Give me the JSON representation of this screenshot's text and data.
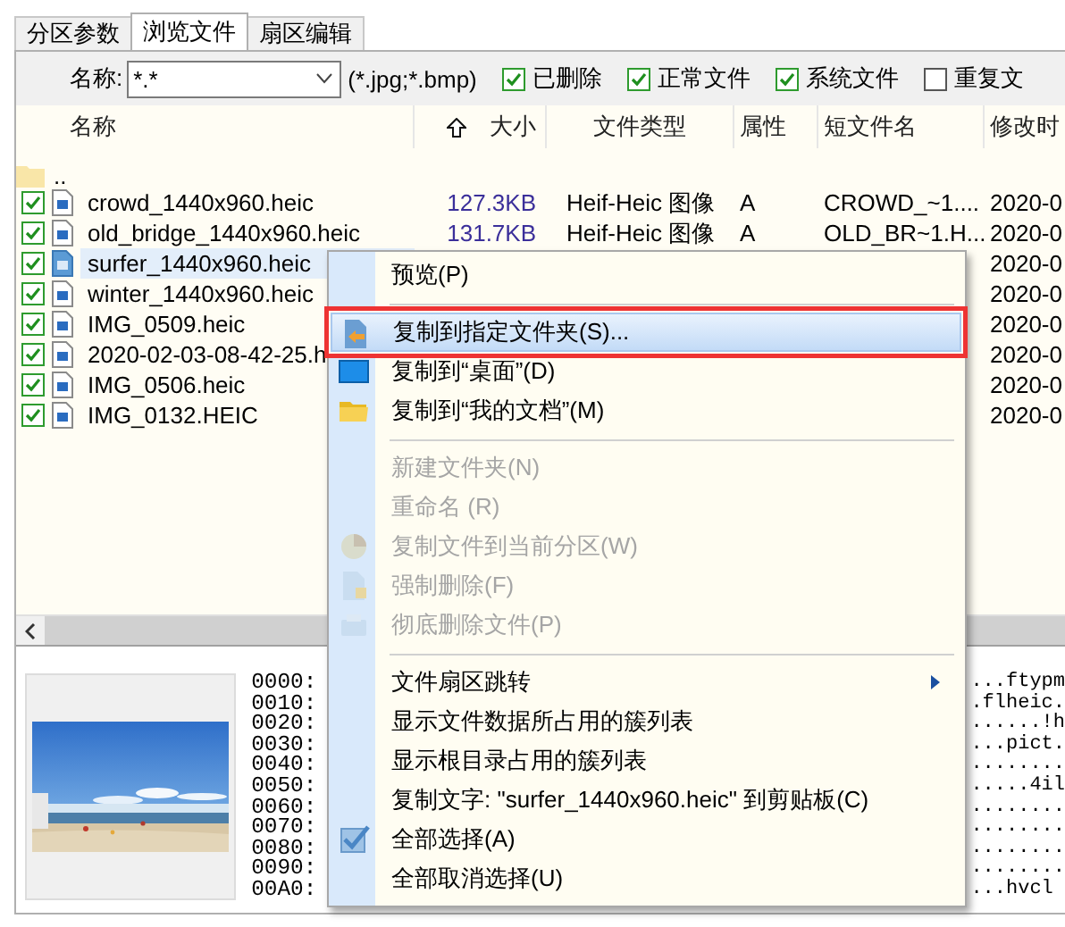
{
  "tabs": [
    {
      "label": "分区参数",
      "selected": false
    },
    {
      "label": "浏览文件",
      "selected": true
    },
    {
      "label": "扇区编辑",
      "selected": false
    }
  ],
  "filter": {
    "name_label": "名称:",
    "name_value": "*.*",
    "hint": "(*.jpg;*.bmp)",
    "options": [
      {
        "label": "已删除",
        "checked": true
      },
      {
        "label": "正常文件",
        "checked": true
      },
      {
        "label": "系统文件",
        "checked": true
      },
      {
        "label": "重复文",
        "checked": false
      }
    ]
  },
  "file_list": {
    "columns": [
      {
        "label": "名称",
        "sorted": false
      },
      {
        "label": "大小",
        "sorted": true
      },
      {
        "label": "文件类型",
        "sorted": false
      },
      {
        "label": "属性",
        "sorted": false
      },
      {
        "label": "短文件名",
        "sorted": false
      },
      {
        "label": "修改时",
        "sorted": false
      }
    ],
    "rows": [
      {
        "kind": "parent",
        "name": ".."
      },
      {
        "kind": "file",
        "checked": true,
        "selected": false,
        "name": "crowd_1440x960.heic",
        "size": "127.3KB",
        "type": "Heif-Heic 图像",
        "attr": "A",
        "short_name": "CROWD_~1....",
        "modified": "2020-0"
      },
      {
        "kind": "file",
        "checked": true,
        "selected": false,
        "name": "old_bridge_1440x960.heic",
        "size": "131.7KB",
        "type": "Heif-Heic 图像",
        "attr": "A",
        "short_name": "OLD_BR~1.H...",
        "modified": "2020-0"
      },
      {
        "kind": "file",
        "checked": true,
        "selected": true,
        "name": "surfer_1440x960.heic",
        "modified": "2020-0"
      },
      {
        "kind": "file",
        "checked": true,
        "selected": false,
        "name": "winter_1440x960.heic",
        "modified": "2020-0"
      },
      {
        "kind": "file",
        "checked": true,
        "selected": false,
        "name": "IMG_0509.heic",
        "modified": "2020-0"
      },
      {
        "kind": "file",
        "checked": true,
        "selected": false,
        "name": "2020-02-03-08-42-25.h",
        "modified": "2020-0"
      },
      {
        "kind": "file",
        "checked": true,
        "selected": false,
        "name": "IMG_0506.heic",
        "modified": "2020-0"
      },
      {
        "kind": "file",
        "checked": true,
        "selected": false,
        "name": "IMG_0132.HEIC",
        "modified": "2020-0"
      }
    ]
  },
  "hex_panel": {
    "offsets": [
      "0000:",
      "0010:",
      "0020:",
      "0030:",
      "0040:",
      "0050:",
      "0060:",
      "0070:",
      "0080:",
      "0090:",
      "00A0:"
    ],
    "ascii": [
      "...ftypm",
      ".flheic.",
      "......!h",
      "...pict.",
      "........",
      ".....4il",
      "........",
      "........",
      "........",
      "........",
      "...hvcl"
    ]
  },
  "context_menu": {
    "items": [
      {
        "kind": "item",
        "label": "预览(P)",
        "disabled": false,
        "highlighted": false,
        "outlined": false,
        "submenu": false
      },
      {
        "kind": "separator"
      },
      {
        "kind": "item",
        "label": "复制到指定文件夹(S)...",
        "disabled": false,
        "highlighted": true,
        "outlined": true,
        "submenu": false
      },
      {
        "kind": "item",
        "label": "复制到“桌面”(D)",
        "disabled": false,
        "highlighted": false,
        "outlined": false,
        "submenu": false
      },
      {
        "kind": "item",
        "label": "复制到“我的文档”(M)",
        "disabled": false,
        "highlighted": false,
        "outlined": false,
        "submenu": false
      },
      {
        "kind": "separator"
      },
      {
        "kind": "item",
        "label": "新建文件夹(N)",
        "disabled": true,
        "highlighted": false,
        "outlined": false,
        "submenu": false
      },
      {
        "kind": "item",
        "label": "重命名 (R)",
        "disabled": true,
        "highlighted": false,
        "outlined": false,
        "submenu": false
      },
      {
        "kind": "item",
        "label": "复制文件到当前分区(W)",
        "disabled": true,
        "highlighted": false,
        "outlined": false,
        "submenu": false
      },
      {
        "kind": "item",
        "label": "强制删除(F)",
        "disabled": true,
        "highlighted": false,
        "outlined": false,
        "submenu": false
      },
      {
        "kind": "item",
        "label": "彻底删除文件(P)",
        "disabled": true,
        "highlighted": false,
        "outlined": false,
        "submenu": false
      },
      {
        "kind": "separator"
      },
      {
        "kind": "item",
        "label": "文件扇区跳转",
        "disabled": false,
        "highlighted": false,
        "outlined": false,
        "submenu": true
      },
      {
        "kind": "item",
        "label": "显示文件数据所占用的簇列表",
        "disabled": false,
        "highlighted": false,
        "outlined": false,
        "submenu": false
      },
      {
        "kind": "item",
        "label": "显示根目录占用的簇列表",
        "disabled": false,
        "highlighted": false,
        "outlined": false,
        "submenu": false
      },
      {
        "kind": "item",
        "label": "复制文字: \"surfer_1440x960.heic\" 到剪贴板(C)",
        "disabled": false,
        "highlighted": false,
        "outlined": false,
        "submenu": false
      },
      {
        "kind": "item",
        "label": "全部选择(A)",
        "disabled": false,
        "highlighted": false,
        "outlined": false,
        "submenu": false
      },
      {
        "kind": "item",
        "label": "全部取消选择(U)",
        "disabled": false,
        "highlighted": false,
        "outlined": false,
        "submenu": false
      }
    ]
  }
}
